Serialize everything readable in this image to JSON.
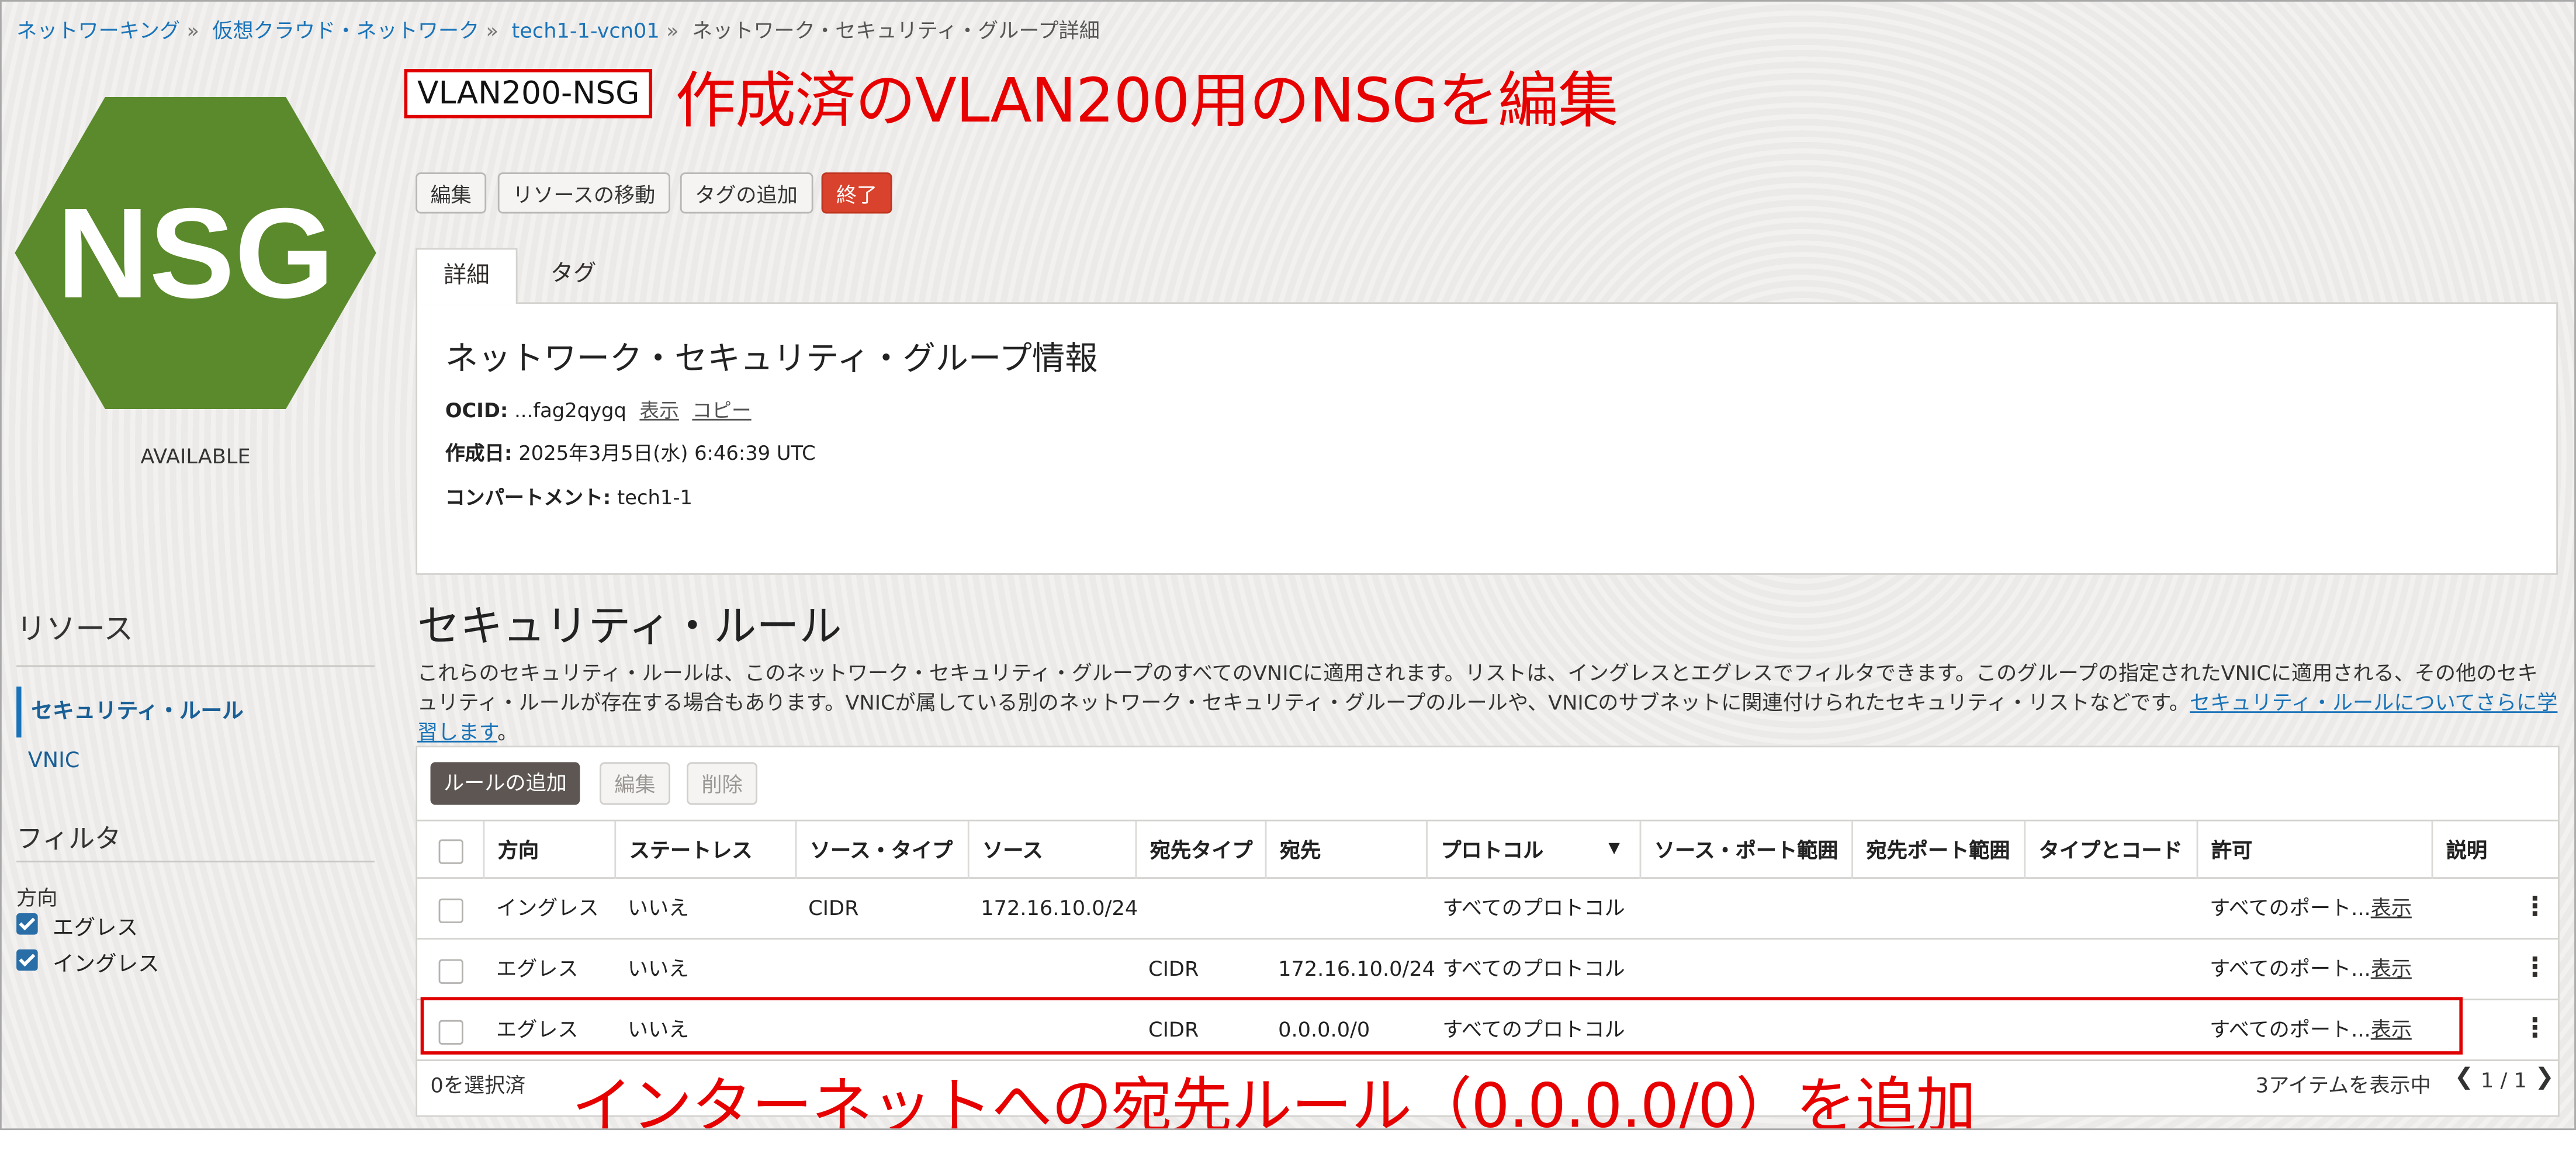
{
  "breadcrumb": [
    "ネットワーキング",
    "仮想クラウド・ネットワーク",
    "tech1-1-vcn01",
    "ネットワーク・セキュリティ・グループ詳細"
  ],
  "logo_text": "NSG",
  "status": "AVAILABLE",
  "page_title": "VLAN200-NSG",
  "annotation_top": "作成済のVLAN200用のNSGを編集",
  "annotation_bottom": "インターネットへの宛先ルール（0.0.0.0/0）を追加",
  "colors": {
    "logo_green": "#5a8a2b",
    "danger": "#d9432d",
    "annotation_red": "#e60000",
    "link": "#1a73b8"
  },
  "actions": {
    "edit": "編集",
    "move": "リソースの移動",
    "add_tag": "タグの追加",
    "terminate": "終了"
  },
  "tabs": [
    "詳細",
    "タグ"
  ],
  "info": {
    "heading": "ネットワーク・セキュリティ・グループ情報",
    "ocid_label": "OCID:",
    "ocid_value": "...fag2qygq",
    "show": "表示",
    "copy": "コピー",
    "created_label": "作成日:",
    "created_value": "2025年3月5日(水) 6:46:39 UTC",
    "compartment_label": "コンパートメント:",
    "compartment_value": "tech1-1"
  },
  "sidebar": {
    "resources_heading": "リソース",
    "items": [
      "セキュリティ・ルール",
      "VNIC"
    ],
    "filter_heading": "フィルタ",
    "direction_label": "方向",
    "filters": [
      "エグレス",
      "イングレス"
    ]
  },
  "rules": {
    "heading": "セキュリティ・ルール",
    "description": "これらのセキュリティ・ルールは、このネットワーク・セキュリティ・グループのすべてのVNICに適用されます。リストは、イングレスとエグレスでフィルタできます。このグループの指定されたVNICに適用される、その他のセキュリティ・ルールが存在する場合もあります。VNICが属している別のネットワーク・セキュリティ・グループのルールや、VNICのサブネットに関連付けられたセキュリティ・リストなどです。",
    "learn_more": "セキュリティ・ルールについてさらに学習します",
    "period": "。",
    "add": "ルールの追加",
    "edit": "編集",
    "delete": "削除",
    "columns": [
      "方向",
      "ステートレス",
      "ソース・タイプ",
      "ソース",
      "宛先タイプ",
      "宛先",
      "プロトコル",
      "ソース・ポート範囲",
      "宛先ポート範囲",
      "タイプとコード",
      "許可",
      "説明"
    ],
    "rows": [
      {
        "direction": "イングレス",
        "stateless": "いいえ",
        "source_type": "CIDR",
        "source": "172.16.10.0/24",
        "dest_type": "",
        "dest": "",
        "protocol": "すべてのプロトコル",
        "allow": "すべてのポート...",
        "show": "表示"
      },
      {
        "direction": "エグレス",
        "stateless": "いいえ",
        "source_type": "",
        "source": "",
        "dest_type": "CIDR",
        "dest": "172.16.10.0/24",
        "protocol": "すべてのプロトコル",
        "allow": "すべてのポート...",
        "show": "表示"
      },
      {
        "direction": "エグレス",
        "stateless": "いいえ",
        "source_type": "",
        "source": "",
        "dest_type": "CIDR",
        "dest": "0.0.0.0/0",
        "protocol": "すべてのプロトコル",
        "allow": "すべてのポート...",
        "show": "表示"
      }
    ],
    "selected": "0を選択済",
    "showing": "3アイテムを表示中",
    "pager": "1 / 1"
  }
}
